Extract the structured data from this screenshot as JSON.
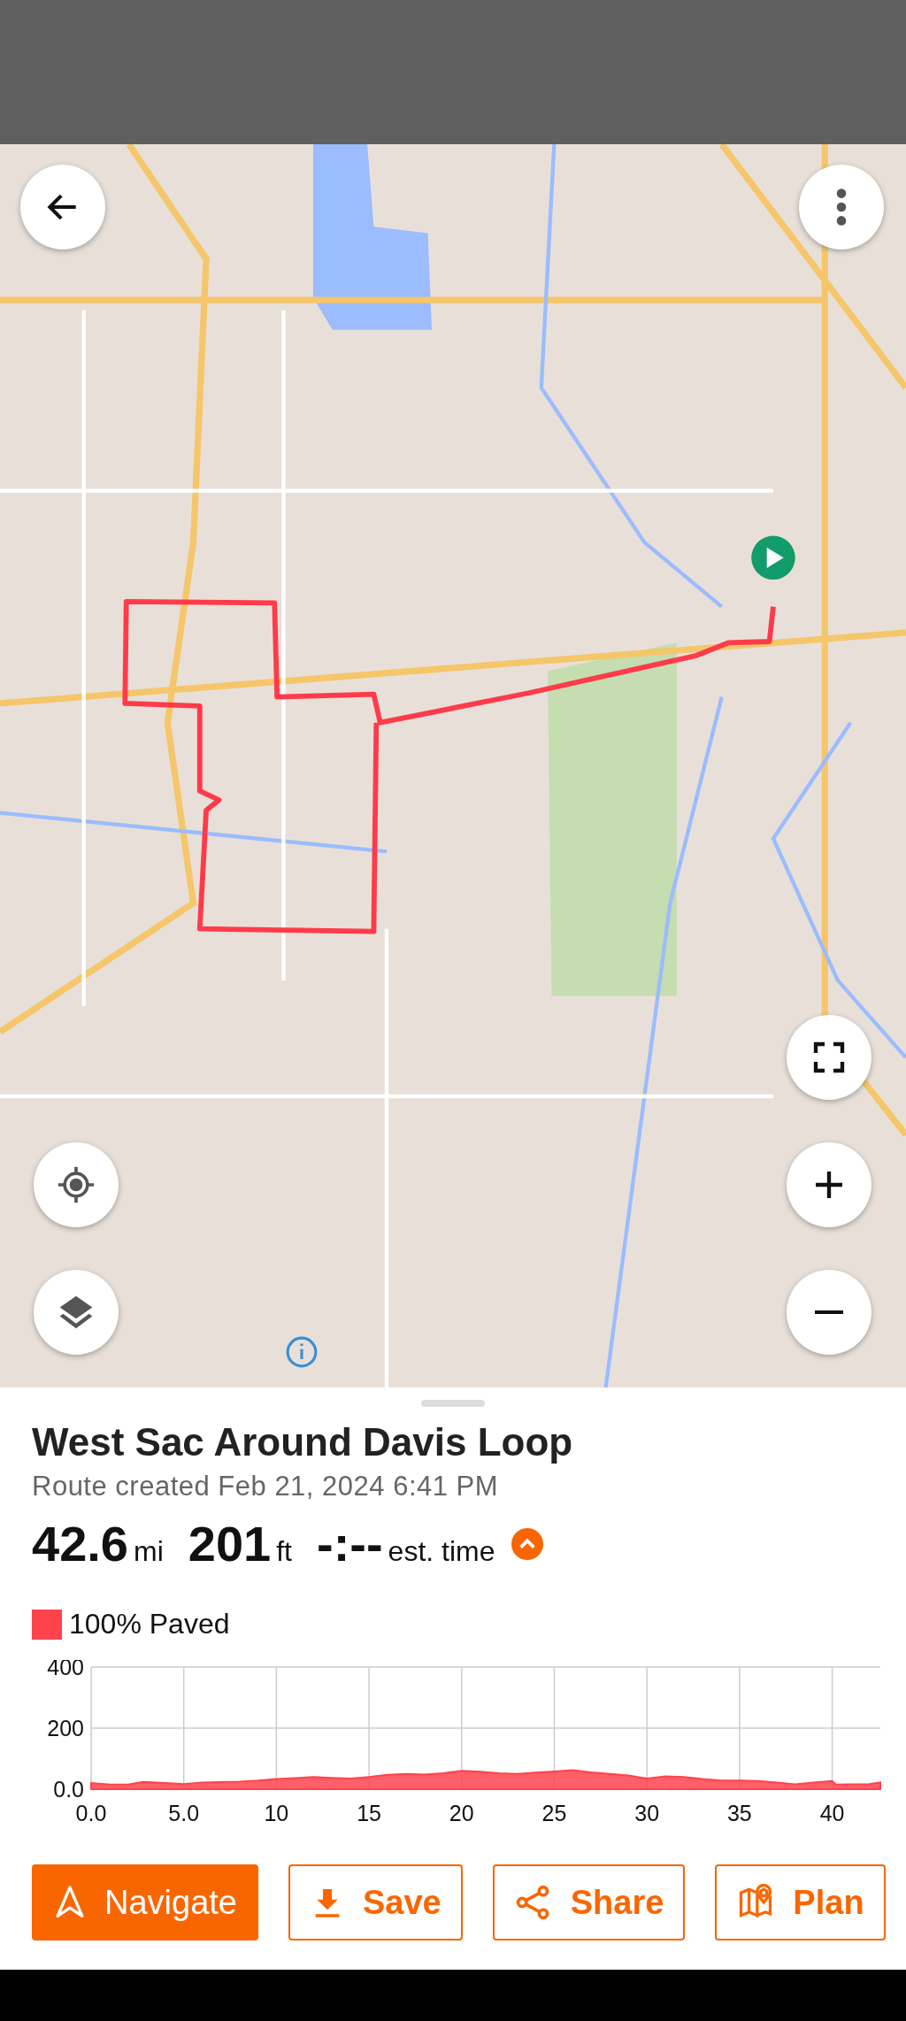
{
  "route": {
    "title": "West Sac Around Davis Loop",
    "subtitle": "Route created Feb 21, 2024 6:41 PM",
    "stats": [
      {
        "value": "42.6",
        "unit": "mi"
      },
      {
        "value": "201",
        "unit": "ft"
      },
      {
        "value": "-:--",
        "unit": "est. time"
      }
    ],
    "surface": {
      "label": "100% Paved",
      "color": "#ff434d"
    },
    "chart_data": {
      "type": "area",
      "x": [
        0,
        1,
        2,
        2.8,
        4,
        5,
        6,
        8,
        9,
        10,
        11,
        12,
        13,
        14,
        15,
        16,
        17,
        18,
        19,
        20,
        21,
        22,
        23,
        24,
        25,
        26,
        27,
        28,
        29,
        30,
        31,
        32,
        33,
        34,
        35,
        36,
        37,
        38,
        39,
        40,
        40.2,
        41,
        42,
        42.6
      ],
      "series": [
        {
          "color": "#ff434d",
          "values": [
            20,
            15,
            15,
            24,
            20,
            17,
            22,
            25,
            28,
            33,
            36,
            40,
            37,
            35,
            40,
            47,
            50,
            48,
            52,
            60,
            57,
            52,
            50,
            54,
            58,
            62,
            55,
            50,
            45,
            35,
            42,
            40,
            33,
            28,
            28,
            27,
            22,
            16,
            22,
            27,
            15,
            16,
            17,
            22
          ]
        }
      ],
      "grid": true,
      "xlim": [
        0,
        42.6
      ],
      "ylim": [
        0,
        400
      ],
      "xticks": [
        {
          "value": 0,
          "label": "0.0"
        },
        {
          "value": 5,
          "label": "5.0"
        },
        10,
        15,
        20,
        25,
        30,
        35,
        40
      ],
      "yticks": [
        {
          "value": 0,
          "label": "0.0"
        },
        200,
        400
      ]
    },
    "buttons": [
      {
        "label": "Navigate",
        "kind": "filled"
      },
      {
        "label": "Save",
        "kind": "outline"
      },
      {
        "label": "Share",
        "kind": "outline"
      },
      {
        "label": "Plan",
        "kind": "outline"
      }
    ]
  }
}
